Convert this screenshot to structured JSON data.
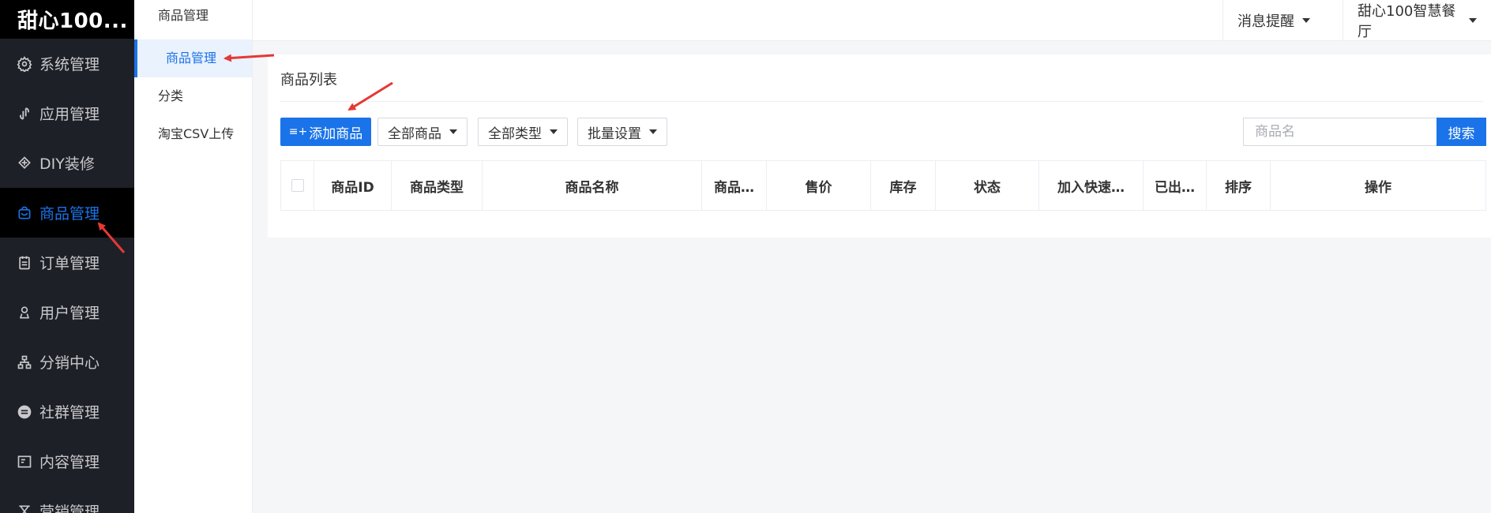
{
  "brand": "甜心100...",
  "sidebar": {
    "items": [
      {
        "label": "系统管理",
        "icon": "gear-icon"
      },
      {
        "label": "应用管理",
        "icon": "link-icon"
      },
      {
        "label": "DIY装修",
        "icon": "paint-icon"
      },
      {
        "label": "商品管理",
        "icon": "bag-icon"
      },
      {
        "label": "订单管理",
        "icon": "clipboard-icon"
      },
      {
        "label": "用户管理",
        "icon": "user-icon"
      },
      {
        "label": "分销中心",
        "icon": "org-chart-icon"
      },
      {
        "label": "社群管理",
        "icon": "community-icon"
      },
      {
        "label": "内容管理",
        "icon": "content-icon"
      },
      {
        "label": "营销管理",
        "icon": "marketing-icon"
      }
    ],
    "active_index": 3
  },
  "subnav": {
    "title": "商品管理",
    "items": [
      "商品管理",
      "分类",
      "淘宝CSV上传"
    ],
    "active_index": 0
  },
  "topbar": {
    "notifications": "消息提醒",
    "store": "甜心100智慧餐厅"
  },
  "main": {
    "title": "商品列表",
    "add_button": "添加商品",
    "filters": [
      "全部商品",
      "全部类型",
      "批量设置"
    ],
    "search": {
      "placeholder": "商品名",
      "button": "搜索"
    },
    "columns": [
      "商品ID",
      "商品类型",
      "商品名称",
      "商品…",
      "售价",
      "库存",
      "状态",
      "加入快速…",
      "已出…",
      "排序",
      "操作"
    ]
  },
  "colors": {
    "accent": "#1a73e8",
    "sidebar_bg": "#1e2027",
    "annotation": "#e53935"
  }
}
